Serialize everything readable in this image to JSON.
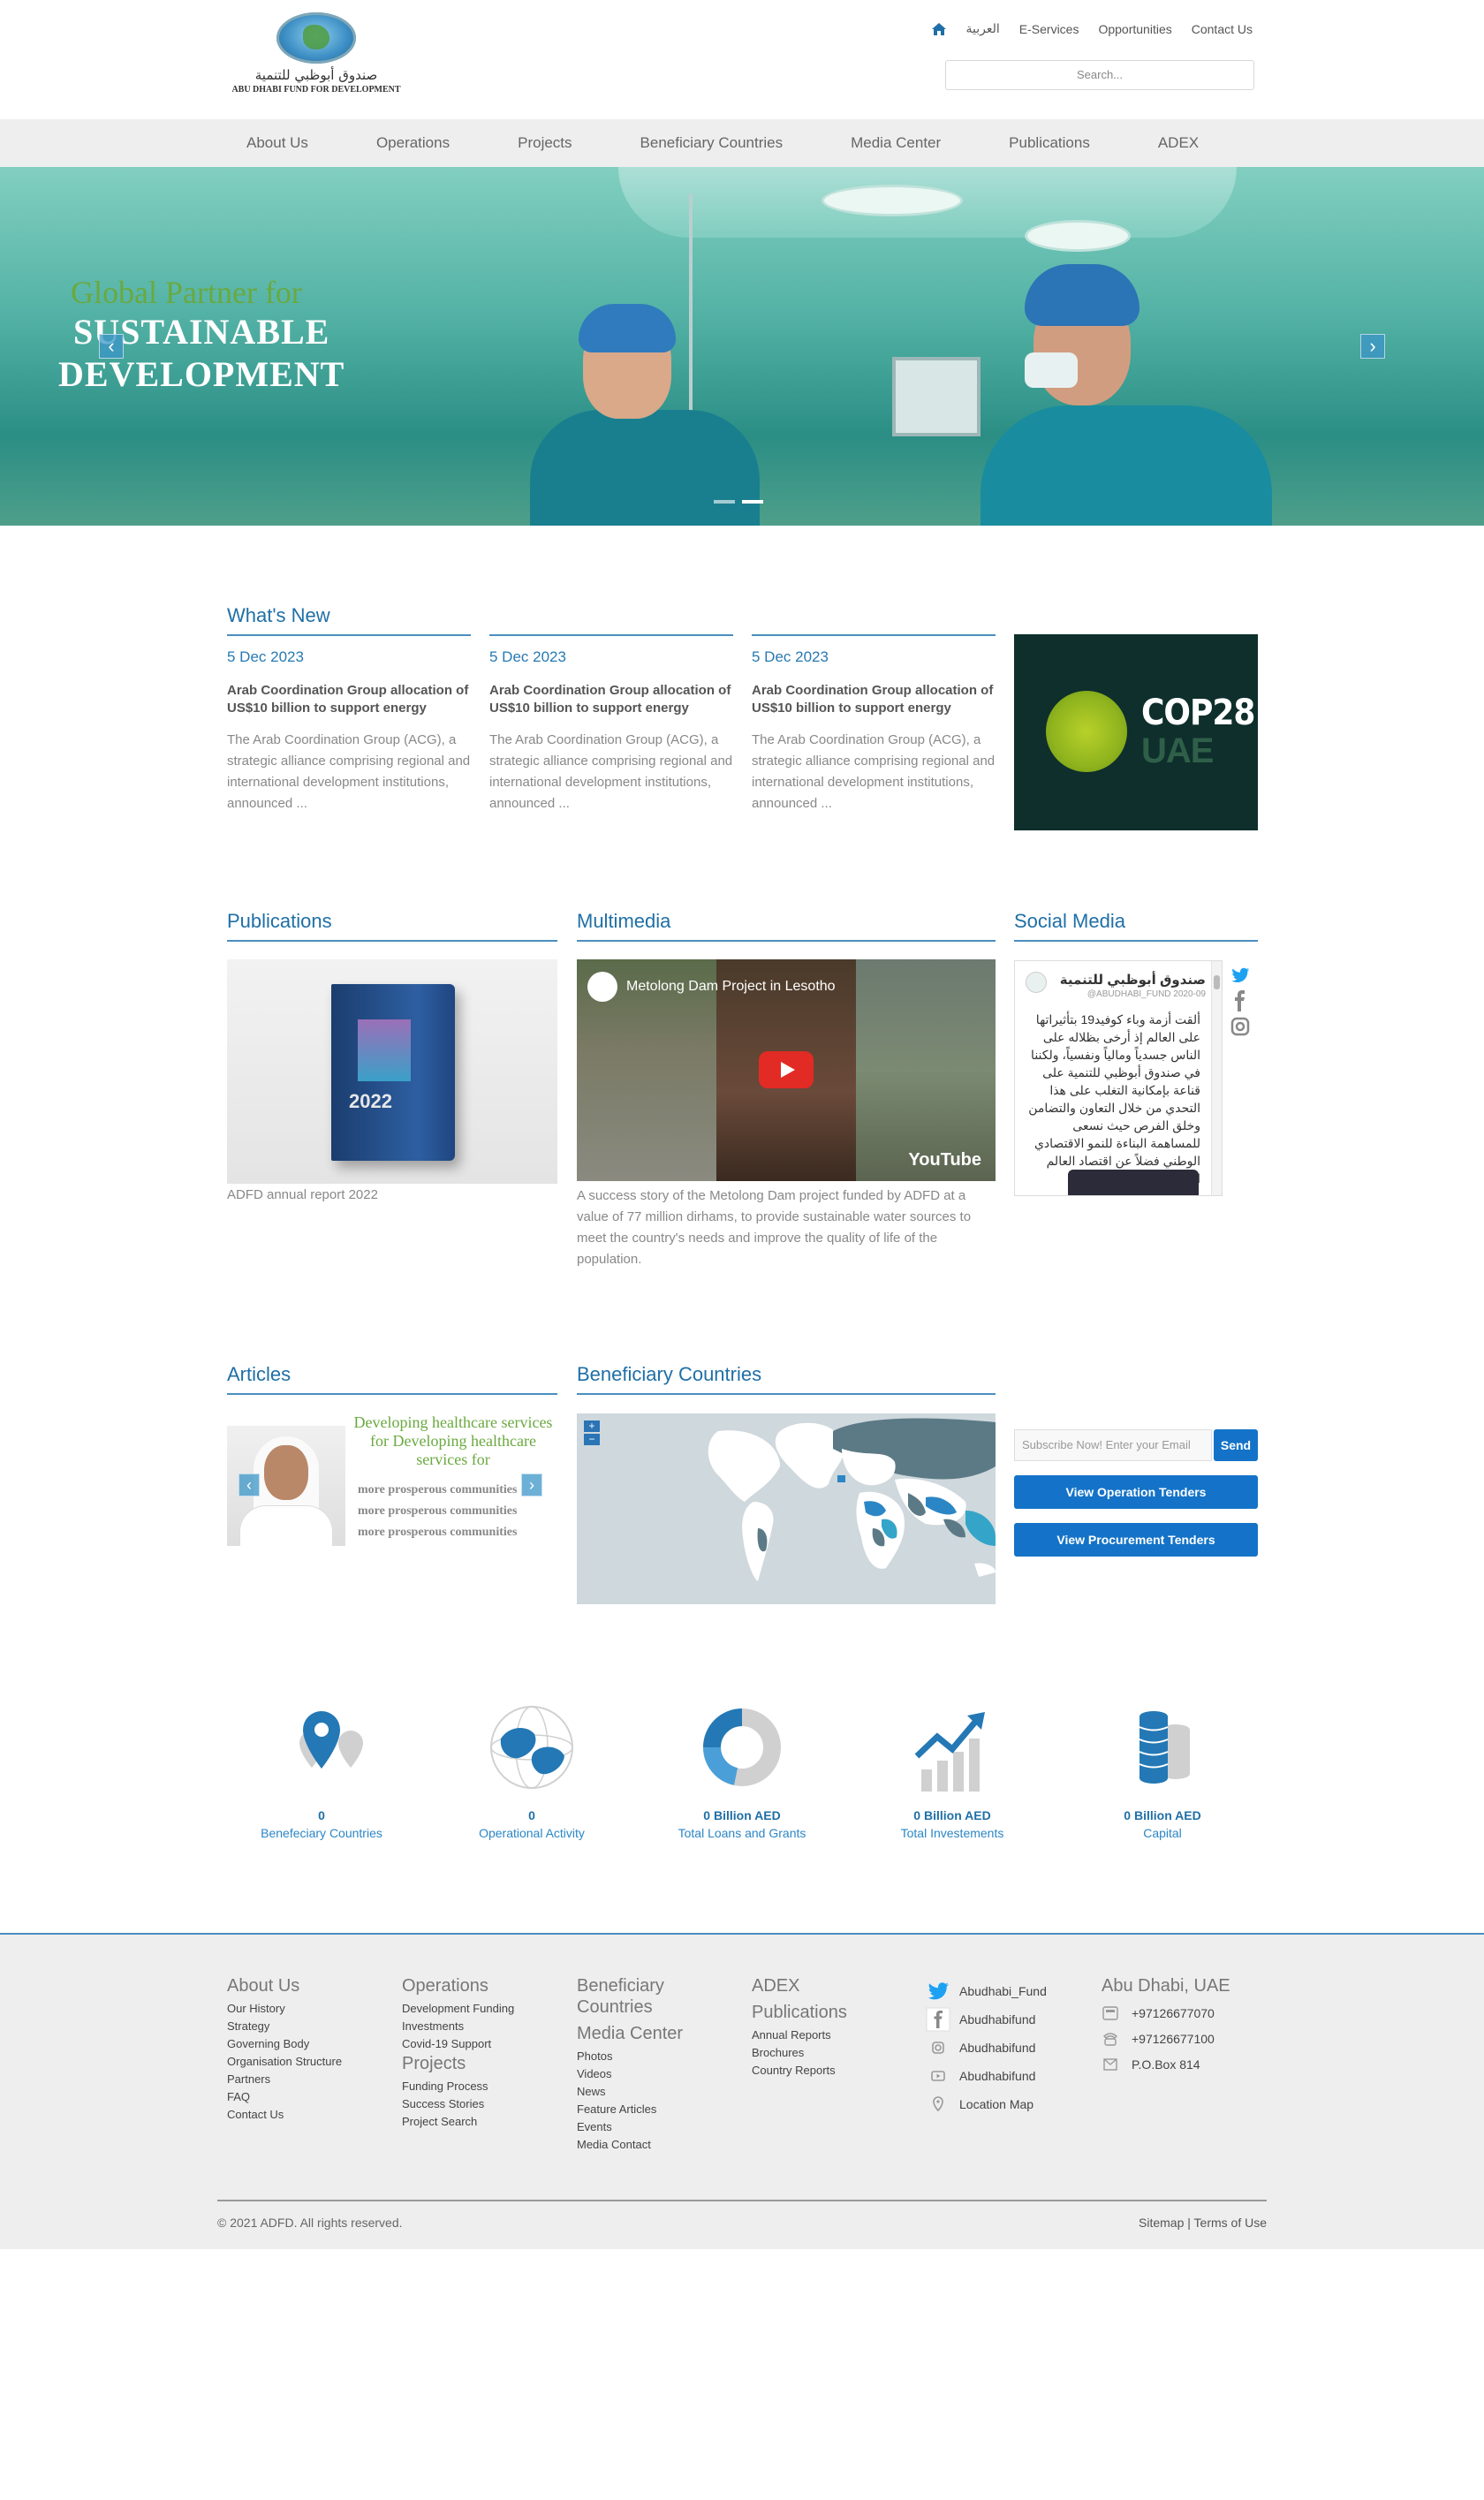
{
  "header": {
    "logo_arabic": "صندوق أبوظبي للتنمية",
    "logo_english": "ABU DHABI FUND FOR DEVELOPMENT",
    "top_links": [
      "العربية",
      "E-Services",
      "Opportunities",
      "Contact Us"
    ],
    "search_placeholder": "Search..."
  },
  "nav": [
    "About Us",
    "Operations",
    "Projects",
    "Beneficiary Countries",
    "Media Center",
    "Publications",
    "ADEX"
  ],
  "hero": {
    "line1": "Global Partner for",
    "line2": "SUSTAINABLE",
    "line3": "DEVELOPMENT"
  },
  "whats_new": {
    "heading": "What's New",
    "items": [
      {
        "date": "5 Dec 2023",
        "title": "Arab Coordination Group allocation of US$10 billion to support energy",
        "body": "The Arab Coordination Group (ACG), a strategic alliance comprising regional and international development institutions, announced ..."
      },
      {
        "date": "5 Dec 2023",
        "title": "Arab Coordination Group allocation of US$10 billion to support energy",
        "body": "The Arab Coordination Group (ACG), a strategic alliance comprising regional and international development institutions, announced ..."
      },
      {
        "date": "5 Dec 2023",
        "title": "Arab Coordination Group allocation of US$10 billion to support energy",
        "body": "The Arab Coordination Group (ACG), a strategic alliance comprising regional and international development institutions, announced ..."
      }
    ],
    "promo_line1": "COP28",
    "promo_line2": "UAE"
  },
  "publications": {
    "heading": "Publications",
    "book_year": "2022",
    "caption": "ADFD annual report 2022"
  },
  "multimedia": {
    "heading": "Multimedia",
    "video_title": "Metolong Dam Project in Lesotho",
    "video_brand": "YouTube",
    "description": "A success story of the Metolong Dam project funded by ADFD at a value of 77 million dirhams, to provide sustainable water sources to meet the country's needs and improve the quality of life of the population."
  },
  "social": {
    "heading": "Social Media",
    "tweet_name": "صندوق أبوظبي للتنمية",
    "tweet_handle": "@ABUDHABI_FUND 2020-09",
    "tweet_text": "ألقت أزمة وباء كوفيد19 بتأثيراتها على العالم إذ أرخى بظلاله على الناس جسدياً ومالياً ونفسياً، ولكننا في صندوق أبوظبي للتنمية على قناعة بإمكانية التغلب على هذا التحدي من خلال التعاون والتضامن وخلق الفرص حيث نسعى للمساهمة البناءة للنمو الاقتصادي الوطني فضلاً عن اقتصاد العالم النامي"
  },
  "articles": {
    "heading": "Articles",
    "title": "Developing healthcare services for Developing healthcare services for",
    "subtitle_lines": [
      "more prosperous communities",
      "more prosperous communities",
      "more prosperous communities"
    ]
  },
  "beneficiary": {
    "heading": "Beneficiary Countries",
    "zoom_in": "+",
    "zoom_out": "−"
  },
  "subscribe": {
    "placeholder": "Subscribe Now! Enter your Email",
    "send": "Send",
    "operation_tenders": "View Operation Tenders",
    "procurement_tenders": "View Procurement Tenders"
  },
  "stats": [
    {
      "value": "0",
      "label": "Benefeciary Countries",
      "icon": "map-pin-icon"
    },
    {
      "value": "0",
      "label": "Operational Activity",
      "icon": "globe-icon"
    },
    {
      "value": "0 Billion AED",
      "label": "Total Loans and Grants",
      "icon": "donut-chart-icon"
    },
    {
      "value": "0 Billion AED",
      "label": "Total Investements",
      "icon": "growth-chart-icon"
    },
    {
      "value": "0 Billion AED",
      "label": "Capital",
      "icon": "coins-icon"
    }
  ],
  "footer": {
    "col1": {
      "heading": "About Us",
      "links": [
        "Our History",
        "Strategy",
        "Governing Body",
        "Organisation Structure",
        "Partners",
        "FAQ",
        "Contact Us"
      ]
    },
    "col2": {
      "heading": "Operations",
      "links": [
        "Development Funding",
        "Investments",
        "Covid-19 Support"
      ],
      "heading2": "Projects",
      "links2": [
        "Funding Process",
        "Success Stories",
        "Project Search"
      ]
    },
    "col3": {
      "heading": "Beneficiary Countries",
      "heading2": "Media Center",
      "links2": [
        "Photos",
        "Videos",
        "News",
        "Feature Articles",
        "Events",
        "Media Contact"
      ]
    },
    "col4": {
      "heading": "ADEX",
      "heading2": "Publications",
      "links2": [
        "Annual Reports",
        "Brochures",
        "Country Reports"
      ]
    },
    "social": [
      "Abudhabi_Fund",
      "Abudhabifund",
      "Abudhabifund",
      "Abudhabifund",
      "Location Map"
    ],
    "contact_heading": "Abu Dhabi, UAE",
    "contacts": [
      "+97126677070",
      "+97126677100",
      "P.O.Box 814"
    ],
    "copyright": "© 2021 ADFD. All rights reserved.",
    "terms": "Sitemap | Terms of Use"
  },
  "colors": {
    "accent": "#1473c8",
    "heading": "#1f6fa6",
    "green": "#6aa93f"
  }
}
